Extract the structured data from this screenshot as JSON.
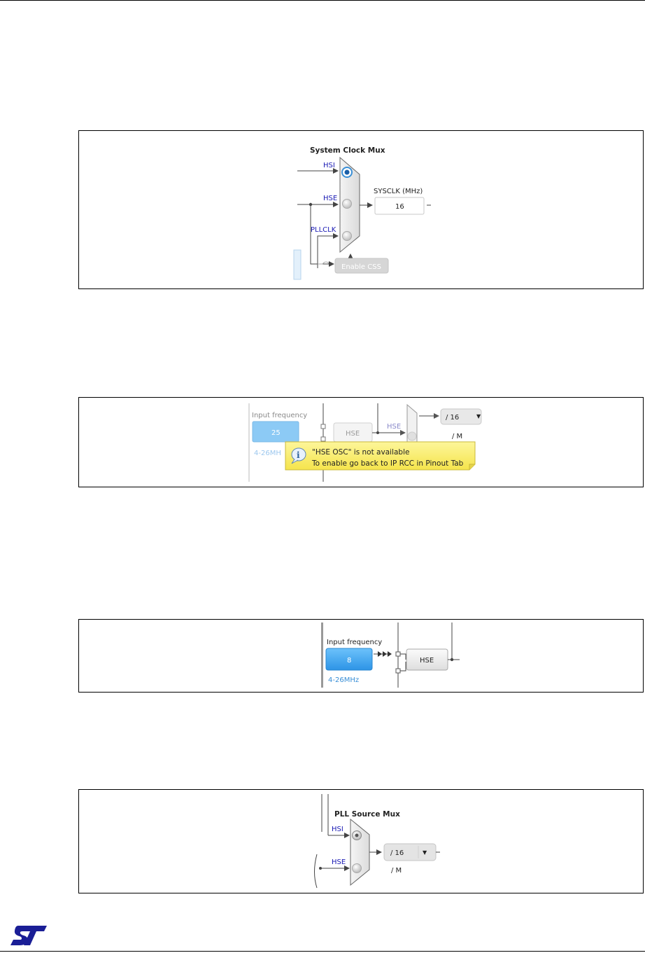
{
  "figure1": {
    "title": "System Clock Mux",
    "inputs": [
      "HSI",
      "HSE",
      "PLLCLK"
    ],
    "selected_input": "HSI",
    "output_label": "SYSCLK (MHz)",
    "output_value": "16",
    "css_button": "Enable CSS"
  },
  "figure2": {
    "input_label": "Input frequency",
    "input_value": "25",
    "range": "4-26MHz",
    "range_visible": "4-26MH",
    "hse_block": "HSE",
    "hse_line": "HSE",
    "divider_value": "/ 16",
    "divider_suffix": "/ M",
    "tooltip_line1": "\"HSE OSC\" is not available",
    "tooltip_line2": "To enable go back to IP RCC in Pinout Tab"
  },
  "figure3": {
    "input_label": "Input frequency",
    "input_value": "8",
    "range": "4-26MHz",
    "hse_block": "HSE"
  },
  "figure4": {
    "title": "PLL Source Mux",
    "inputs": [
      "HSI",
      "HSE"
    ],
    "selected_input": "HSI",
    "divider_value": "/ 16",
    "divider_suffix": "/ M"
  },
  "logo": {
    "name": "st-logo",
    "color": "#1a1e96"
  },
  "colors": {
    "tooltip_bg": "#faf07a",
    "input_blue": "#3fa6f0",
    "label_blue": "#1a1ab4"
  }
}
